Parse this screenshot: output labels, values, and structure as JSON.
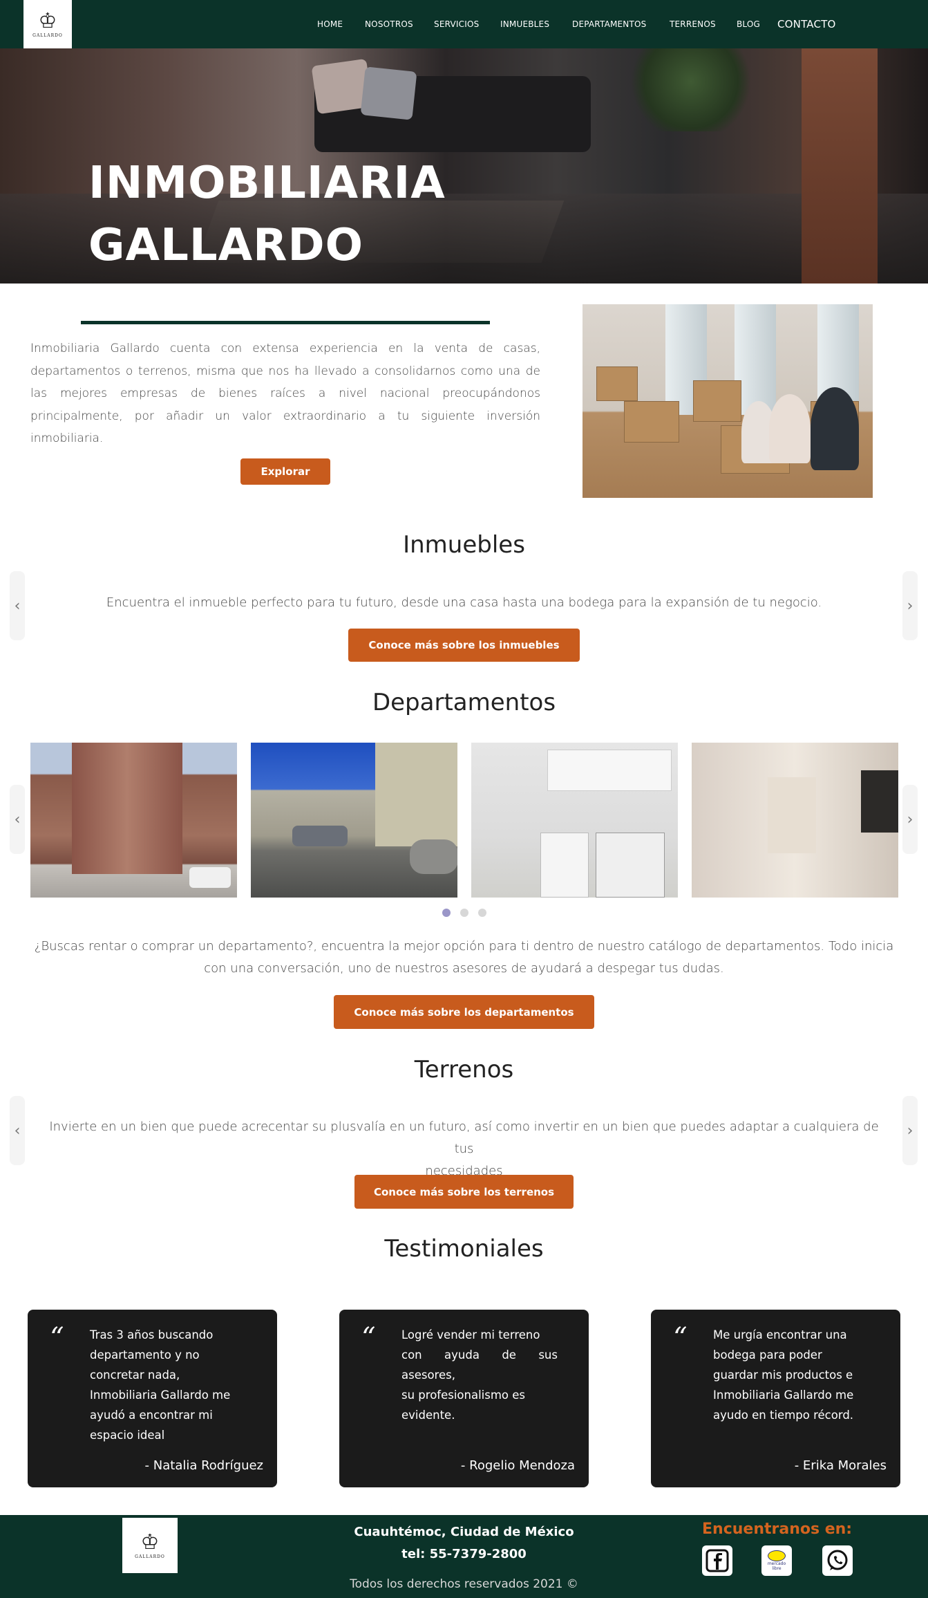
{
  "header": {
    "logo_text": "GALLARDO",
    "nav": [
      "HOME",
      "NOSOTROS",
      "SERVICIOS",
      "INMUEBLES",
      "DEPARTAMENTOS",
      "TERRENOS",
      "BLOG",
      "CONTACTO"
    ]
  },
  "hero": {
    "title_line1": "INMOBILIARIA",
    "title_line2": "GALLARDO"
  },
  "intro": {
    "text": "Inmobiliaria Gallardo cuenta con extensa experiencia en la venta de casas, departamentos o terrenos, misma que nos ha llevado a consolidarnos como una de las mejores empresas de bienes raíces a nivel nacional preocupándonos principalmente, por añadir un valor extraordinario a tu siguiente inversión inmobiliaria.",
    "button": "Explorar"
  },
  "inmuebles": {
    "title": "Inmuebles",
    "text": "Encuentra el inmueble perfecto para tu futuro, desde una casa hasta una bodega para la expansión de tu negocio.",
    "button": "Conoce más sobre los inmuebles"
  },
  "departamentos": {
    "title": "Departamentos",
    "text_line1": "¿Buscas rentar o comprar un departamento?, encuentra la mejor opción para ti dentro de nuestro catálogo de departamentos. Todo inicia",
    "text_line2": "con una conversación, uno de nuestros asesores de ayudará a despegar tus dudas.",
    "button": "Conoce más sobre los departamentos"
  },
  "terrenos": {
    "title": "Terrenos",
    "text_line1": "Invierte en un bien que puede acrecentar su plusvalía en un futuro, así como invertir en un bien que puedes adaptar a cualquiera de tus",
    "text_line2": "necesidades",
    "button": "Conoce más sobre los terrenos"
  },
  "testimoniales": {
    "title": "Testimoniales",
    "items": [
      {
        "lines": [
          "Tras 3 años buscando",
          "departamento y no",
          "concretar nada,",
          "Inmobiliaria Gallardo me",
          "ayudó a encontrar mi",
          "espacio ideal"
        ],
        "name": "- Natalia Rodríguez"
      },
      {
        "lines": [
          "Logré vender mi terreno",
          "con ayuda de sus asesores,",
          "su profesionalismo es",
          "evidente."
        ],
        "name": "- Rogelio Mendoza"
      },
      {
        "lines": [
          "Me urgía encontrar una",
          "bodega para poder",
          "guardar mis productos e",
          "Inmobiliaria Gallardo me",
          "ayudo en tiempo récord."
        ],
        "name": "- Erika Morales"
      }
    ]
  },
  "footer": {
    "logo_text": "GALLARDO",
    "location": "Cuauhtémoc, Ciudad de México",
    "phone": "tel: 55-7379-2800",
    "rights": "Todos los derechos reservados 2021 ©",
    "social_title": "Encuentranos en:",
    "social_icons": [
      "facebook-icon",
      "mercadolibre-icon",
      "whatsapp-icon"
    ],
    "mercado_label": "mercado libre"
  },
  "colors": {
    "brand_green": "#0b3329",
    "accent_orange": "#c85b1d",
    "card_dark": "#1b1b1b"
  }
}
